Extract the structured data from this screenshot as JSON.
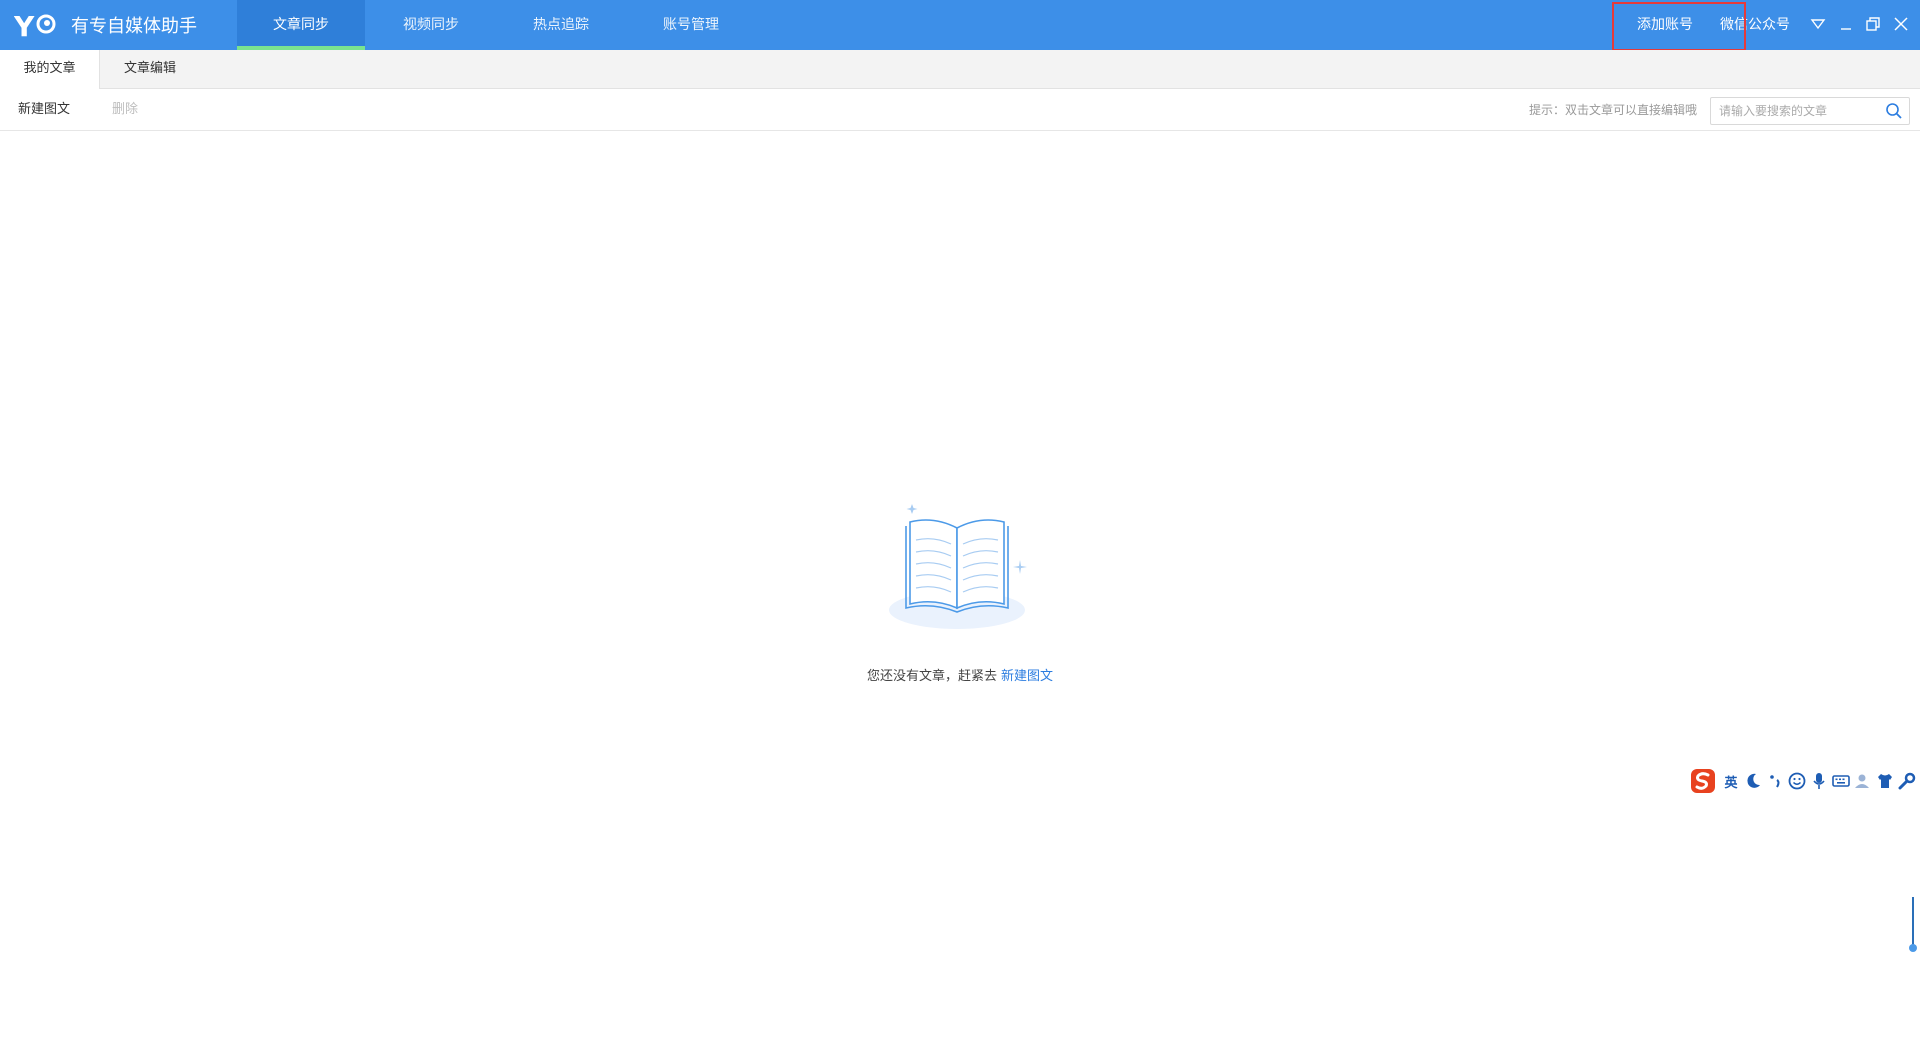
{
  "app": {
    "name": "有专自媒体助手"
  },
  "nav": {
    "tabs": [
      {
        "label": "文章同步",
        "active": true
      },
      {
        "label": "视频同步",
        "active": false
      },
      {
        "label": "热点追踪",
        "active": false
      },
      {
        "label": "账号管理",
        "active": false
      }
    ]
  },
  "titlebar": {
    "add_account": "添加账号",
    "wechat_mp": "微信公众号"
  },
  "subtabs": [
    {
      "label": "我的文章",
      "active": true
    },
    {
      "label": "文章编辑",
      "active": false
    }
  ],
  "toolbar": {
    "new_label": "新建图文",
    "delete_label": "删除",
    "hint": "提示：双击文章可以直接编辑哦",
    "search_placeholder": "请输入要搜索的文章"
  },
  "empty": {
    "message": "您还没有文章，赶紧去",
    "link": "新建图文"
  },
  "ime": {
    "mode": "英"
  },
  "colors": {
    "titlebar": "#3d8fe8",
    "active_tab_underline": "#79e38f",
    "link": "#2c7de0",
    "highlight": "#e53a3a"
  }
}
